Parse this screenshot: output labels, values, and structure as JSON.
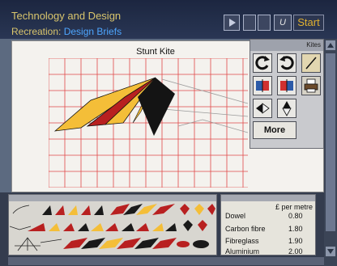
{
  "header": {
    "title": "Technology and Design",
    "subtitle_prefix": "Recreation: ",
    "subtitle_accent": "Design Briefs",
    "toolbar": {
      "u_label": "U",
      "start_label": "Start"
    }
  },
  "kite_window": {
    "title": "Stunt Kite"
  },
  "kites_palette": {
    "title": "Kites",
    "more_label": "More"
  },
  "materials": {
    "header": "£ per metre",
    "items": [
      {
        "name": "Dowel",
        "price": "0.80"
      },
      {
        "name": "Carbon fibre",
        "price": "1.80"
      },
      {
        "name": "Fibreglass",
        "price": "1.90"
      },
      {
        "name": "Aluminium",
        "price": "2.00"
      }
    ]
  },
  "colors": {
    "grid": "#e04848",
    "kite_yellow": "#f4be38",
    "kite_red": "#b82020",
    "kite_black": "#141414",
    "title_yellow": "#d9c56c",
    "subtitle_blue": "#4ea6ff"
  }
}
